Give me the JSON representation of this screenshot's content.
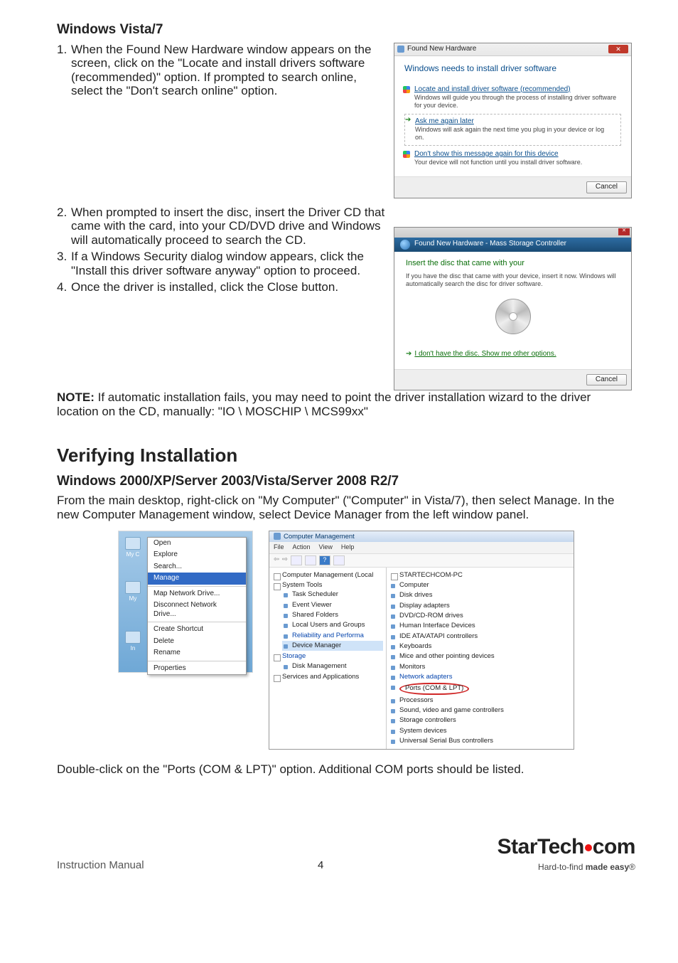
{
  "section1": {
    "title": "Windows Vista/7",
    "steps": [
      "When the Found New Hardware window appears on the screen, click on the \"Locate and install drivers software (recommended)\" option. If prompted to search online, select the \"Don't search online\" option.",
      "When prompted to insert the disc, insert the Driver CD that came with the card, into your CD/DVD drive and Windows will automatically proceed to search the CD.",
      "If a Windows Security dialog window appears, click the \"Install this driver software anyway\" option to proceed.",
      "Once the driver is installed, click the Close button."
    ],
    "note_label": "NOTE:",
    "note_text": " If automatic installation fails, you may need to point the driver installation wizard to the driver location on the CD, manually: \"IO \\ MOSCHIP \\ MCS99xx\""
  },
  "dialog1": {
    "title": "Found New Hardware",
    "headline": "Windows needs to install driver software",
    "opt1_link": "Locate and install driver software (recommended)",
    "opt1_desc": "Windows will guide you through the process of installing driver software for your device.",
    "opt2_link": "Ask me again later",
    "opt2_desc": "Windows will ask again the next time you plug in your device or log on.",
    "opt3_link": "Don't show this message again for this device",
    "opt3_desc": "Your device will not function until you install driver software.",
    "cancel": "Cancel"
  },
  "dialog2": {
    "bar": "Found New Hardware - Mass Storage Controller",
    "headline": "Insert the disc that came with your",
    "sub": "If you have the disc that came with your device, insert it now. Windows will automatically search the disc for driver software.",
    "link": "I don't have the disc. Show me other options.",
    "cancel": "Cancel"
  },
  "section2": {
    "heading": "Verifying Installation",
    "subheading": "Windows 2000/XP/Server 2003/Vista/Server 2008 R2/7",
    "para1": "From the main desktop, right-click on \"My Computer\" (\"Computer\" in Vista/7), then select Manage. In the new Computer Management window, select Device Manager from the left window panel.",
    "para2": "Double-click on the \"Ports (COM & LPT)\" option. Additional COM ports should be listed."
  },
  "ctxmenu": {
    "icons": [
      "My C",
      "My",
      "In"
    ],
    "items_top": [
      "Open",
      "Explore",
      "Search..."
    ],
    "item_sel": "Manage",
    "items_mid": [
      "Map Network Drive...",
      "Disconnect Network Drive..."
    ],
    "items_mid2": [
      "Create Shortcut",
      "Delete",
      "Rename"
    ],
    "items_bot": [
      "Properties"
    ]
  },
  "cm": {
    "title": "Computer Management",
    "menus": [
      "File",
      "Action",
      "View",
      "Help"
    ],
    "left_tree": {
      "root": "Computer Management (Local",
      "sys": "System Tools",
      "sys_children": [
        "Task Scheduler",
        "Event Viewer",
        "Shared Folders",
        "Local Users and Groups",
        "Reliability and Performa",
        "Device Manager"
      ],
      "storage": "Storage",
      "storage_child": "Disk Management",
      "services": "Services and Applications"
    },
    "right_tree": {
      "root": "STARTECHCOM-PC",
      "items": [
        "Computer",
        "Disk drives",
        "Display adapters",
        "DVD/CD-ROM drives",
        "Human Interface Devices",
        "IDE ATA/ATAPI controllers",
        "Keyboards",
        "Mice and other pointing devices",
        "Monitors",
        "Network adapters"
      ],
      "ports": "Ports (COM & LPT)",
      "items2": [
        "Processors",
        "Sound, video and game controllers",
        "Storage controllers",
        "System devices",
        "Universal Serial Bus controllers"
      ]
    }
  },
  "footer": {
    "manual": "Instruction Manual",
    "page": "4",
    "brand1": "StarTech",
    "brand2": "com",
    "tag_pre": "Hard-to-find ",
    "tag_bold": "made easy",
    "tag_reg": "®"
  }
}
